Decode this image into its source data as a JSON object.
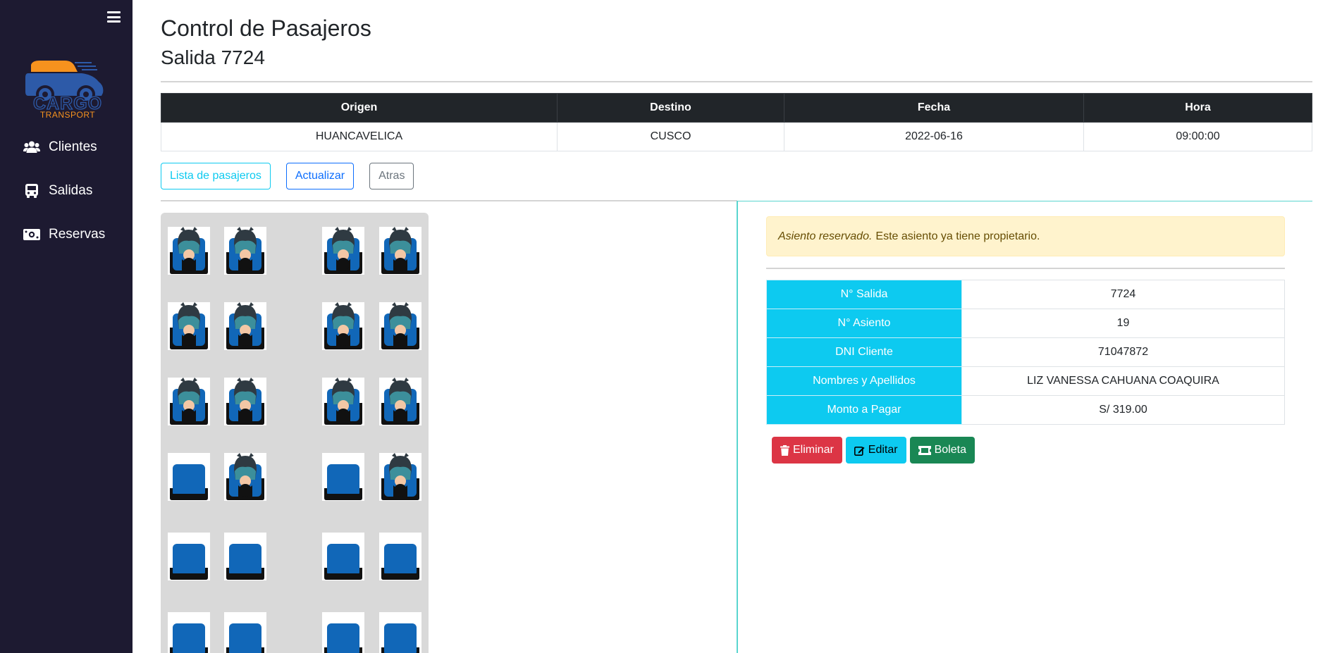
{
  "sidebar": {
    "logo": {
      "text1": "CARGO",
      "text2": "TRANSPORT",
      "colors": {
        "orange": "#f6921e",
        "blue": "#2d5aa8"
      }
    },
    "items": [
      {
        "label": "Clientes",
        "icon": "users-icon"
      },
      {
        "label": "Salidas",
        "icon": "bus-icon"
      },
      {
        "label": "Reservas",
        "icon": "money-bill-icon"
      }
    ]
  },
  "page": {
    "title": "Control de Pasajeros",
    "subtitle": "Salida 7724"
  },
  "trip": {
    "headers": [
      "Origen",
      "Destino",
      "Fecha",
      "Hora"
    ],
    "row": [
      "HUANCAVELICA",
      "CUSCO",
      "2022-06-16",
      "09:00:00"
    ]
  },
  "buttons": {
    "list": "Lista de pasajeros",
    "refresh": "Actualizar",
    "back": "Atras"
  },
  "seats": {
    "rows": [
      [
        "occupied",
        "occupied",
        "occupied",
        "occupied"
      ],
      [
        "occupied",
        "occupied",
        "occupied",
        "occupied"
      ],
      [
        "occupied",
        "occupied",
        "occupied",
        "occupied"
      ],
      [
        "free",
        "occupied",
        "free",
        "occupied"
      ],
      [
        "free",
        "free",
        "free",
        "free"
      ],
      [
        "free",
        "free",
        "free",
        "free"
      ]
    ]
  },
  "alert": {
    "strong": "Asiento reservado.",
    "text": "Este asiento ya tiene propietario."
  },
  "detail": [
    {
      "label": "N° Salida",
      "value": "7724"
    },
    {
      "label": "N° Asiento",
      "value": "19"
    },
    {
      "label": "DNI Cliente",
      "value": "71047872"
    },
    {
      "label": "Nombres y Apellidos",
      "value": "LIZ VANESSA CAHUANA COAQUIRA"
    },
    {
      "label": "Monto a Pagar",
      "value": "S/ 319.00"
    }
  ],
  "actions": {
    "delete": "Eliminar",
    "edit": "Editar",
    "receipt": "Boleta"
  }
}
